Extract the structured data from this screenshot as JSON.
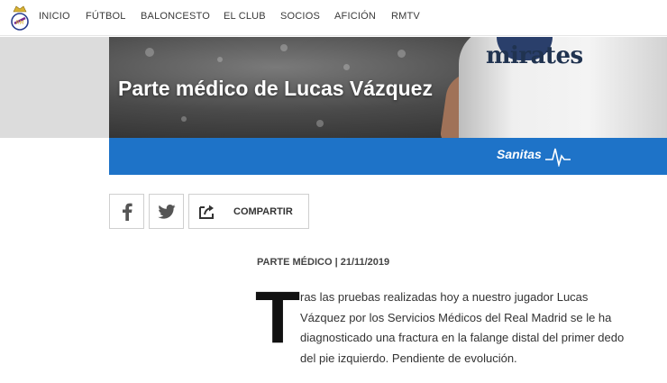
{
  "nav": {
    "items": [
      {
        "label": "INICIO"
      },
      {
        "label": "FÚTBOL"
      },
      {
        "label": "BALONCESTO"
      },
      {
        "label": "EL CLUB"
      },
      {
        "label": "SOCIOS"
      },
      {
        "label": "AFICIÓN"
      },
      {
        "label": "RMTV"
      }
    ]
  },
  "hero": {
    "title": "Parte médico de Lucas Vázquez",
    "jersey_sponsor": "mirates"
  },
  "sponsor_bar": {
    "brand": "Sanitas",
    "color": "#1e73c8"
  },
  "share": {
    "facebook_icon": "facebook-icon",
    "twitter_icon": "twitter-icon",
    "share_icon": "share-icon",
    "label": "COMPARTIR"
  },
  "article": {
    "meta": "PARTE MÉDICO | 21/11/2019",
    "dropcap": "T",
    "lines": [
      "ras las pruebas realizadas hoy a nuestro jugador Lucas",
      "Vázquez por los Servicios Médicos del Real Madrid se le ha",
      "diagnosticado una fractura en la falange distal del primer dedo",
      "del pie izquierdo. Pendiente de evolución."
    ]
  }
}
